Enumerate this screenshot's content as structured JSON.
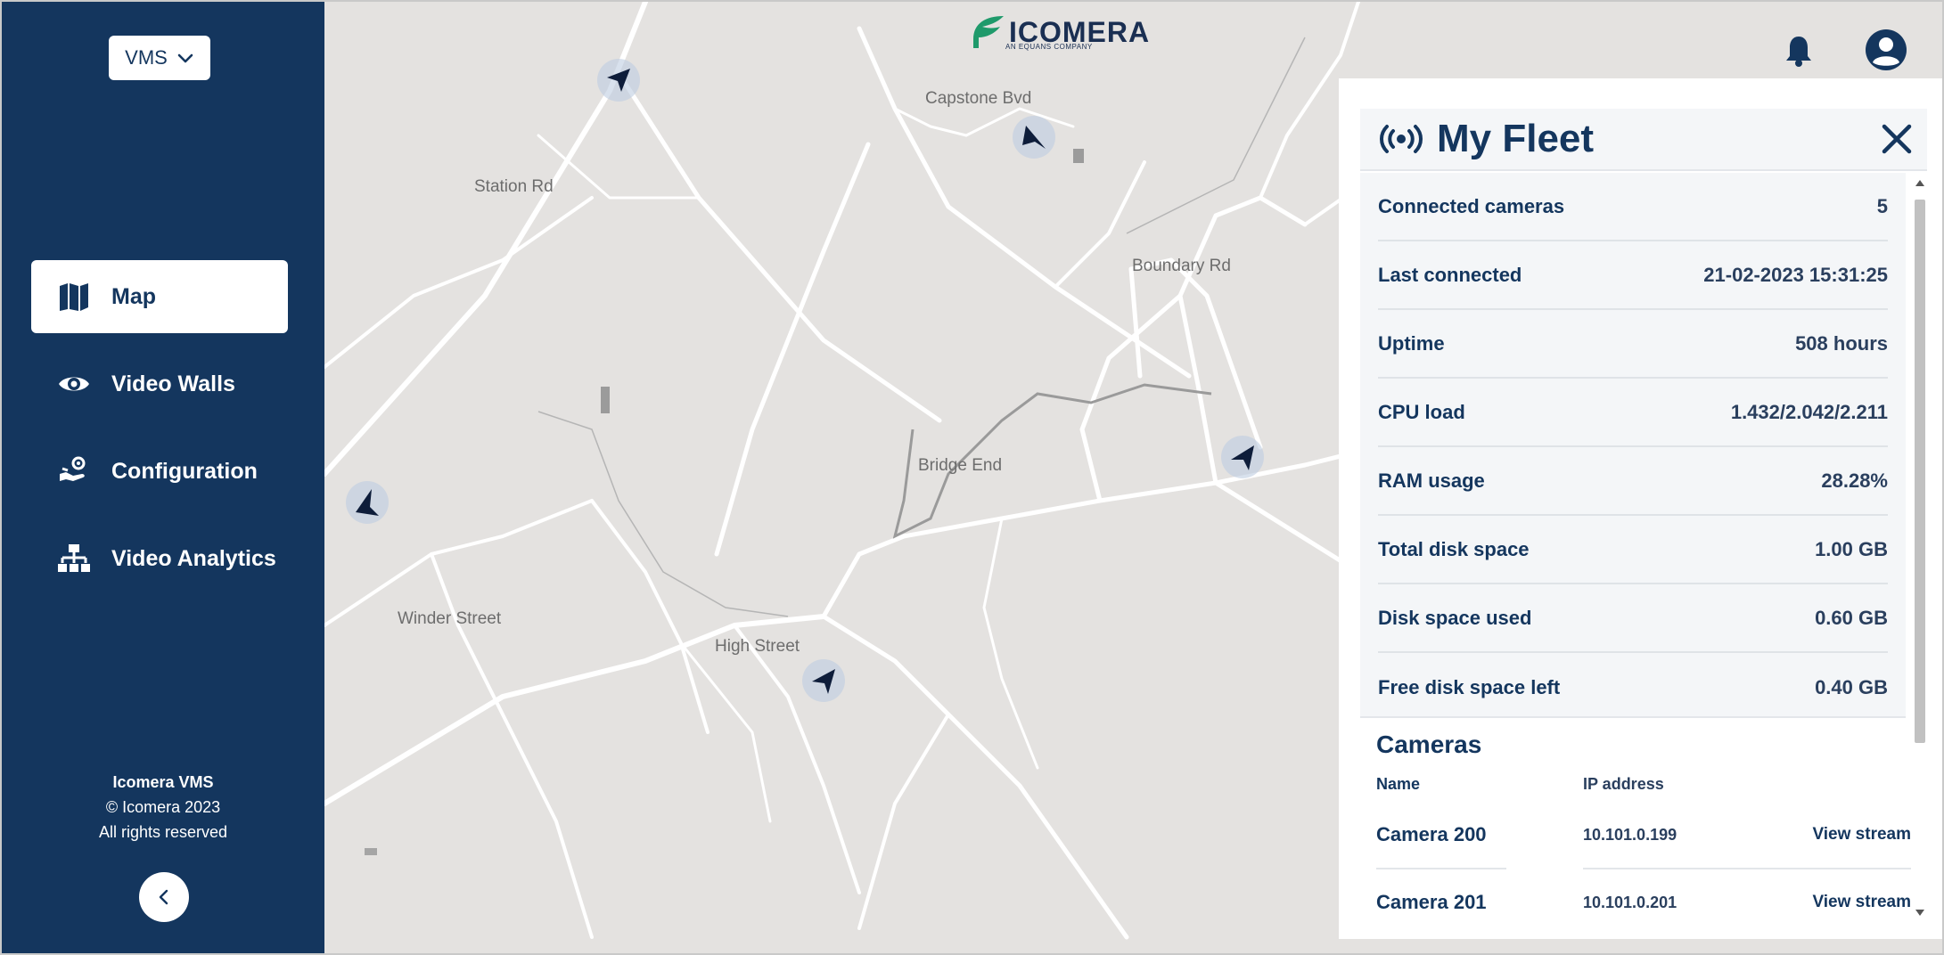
{
  "sidebar": {
    "app_switcher": {
      "label": "VMS",
      "icon": "chevron-down-icon"
    },
    "nav": [
      {
        "label": "Map",
        "icon": "map-icon",
        "active": true
      },
      {
        "label": "Video Walls",
        "icon": "eye-icon",
        "active": false
      },
      {
        "label": "Configuration",
        "icon": "configuration-icon",
        "active": false
      },
      {
        "label": "Video Analytics",
        "icon": "hierarchy-icon",
        "active": false
      }
    ],
    "footer": {
      "brand": "Icomera VMS",
      "copyright": "© Icomera 2023",
      "rights": "All rights reserved"
    },
    "collapse_icon": "chevron-left-icon"
  },
  "header": {
    "logo_text": "ICOMERA",
    "logo_tagline": "AN EQUANS COMPANY",
    "notification_icon": "bell-icon",
    "account_icon": "user-circle-icon"
  },
  "map": {
    "streets": [
      "Capstone Bvd",
      "Station Rd",
      "Boundary Rd",
      "Bridge End",
      "Winder Street",
      "High Street"
    ],
    "marker_icon": "navigation-arrow-icon"
  },
  "fleet_panel": {
    "title": "My Fleet",
    "title_icon": "broadcast-icon",
    "close_icon": "close-icon",
    "stats": [
      {
        "label": "Connected cameras",
        "value": "5"
      },
      {
        "label": "Last connected",
        "value": "21-02-2023 15:31:25"
      },
      {
        "label": "Uptime",
        "value": "508 hours"
      },
      {
        "label": "CPU load",
        "value": "1.432/2.042/2.211"
      },
      {
        "label": "RAM usage",
        "value": "28.28%"
      },
      {
        "label": "Total disk space",
        "value": "1.00 GB"
      },
      {
        "label": "Disk space used",
        "value": "0.60 GB"
      },
      {
        "label": "Free disk space left",
        "value": "0.40 GB"
      }
    ],
    "cameras": {
      "heading": "Cameras",
      "columns": {
        "name": "Name",
        "ip": "IP address"
      },
      "rows": [
        {
          "name": "Camera 200",
          "ip": "10.101.0.199",
          "action": "View stream"
        },
        {
          "name": "Camera 201",
          "ip": "10.101.0.201",
          "action": "View stream"
        }
      ]
    }
  },
  "colors": {
    "sidebar_bg": "#14365e",
    "accent": "#14365e",
    "map_bg": "#e4e2e0",
    "logo_green": "#1f9a6b"
  }
}
